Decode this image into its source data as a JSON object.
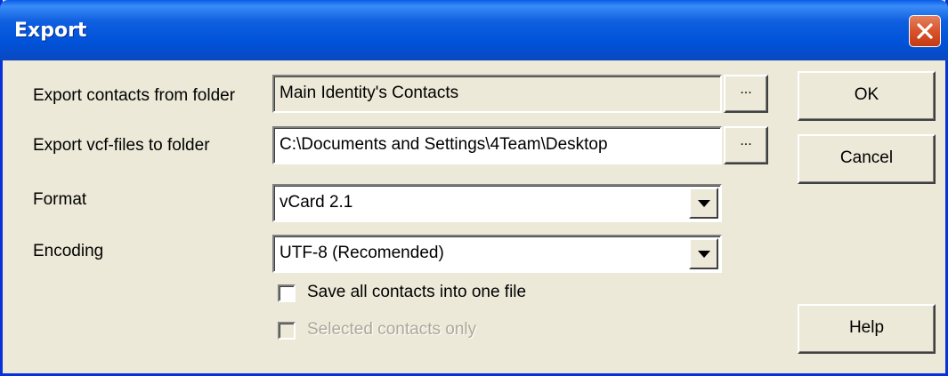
{
  "window": {
    "title": "Export",
    "colors": {
      "titlebar": "#0052d8",
      "close": "#d9532b",
      "face": "#ece9d8"
    }
  },
  "icons": {
    "close": "close-icon",
    "dropdown": "chevron-down-icon"
  },
  "fields": {
    "from_folder": {
      "label": "Export contacts from folder",
      "value": "Main Identity's Contacts",
      "browse_label": "..."
    },
    "to_folder": {
      "label": "Export vcf-files to folder",
      "value": "C:\\Documents and Settings\\4Team\\Desktop",
      "browse_label": "..."
    },
    "format": {
      "label": "Format",
      "value": "vCard 2.1"
    },
    "encoding": {
      "label": "Encoding",
      "value": "UTF-8 (Recomended)"
    }
  },
  "checkboxes": {
    "one_file": {
      "label": "Save all contacts into one file",
      "checked": false,
      "enabled": true
    },
    "selected_only": {
      "label": "Selected contacts only",
      "checked": false,
      "enabled": false
    }
  },
  "buttons": {
    "ok": "OK",
    "cancel": "Cancel",
    "help": "Help"
  }
}
